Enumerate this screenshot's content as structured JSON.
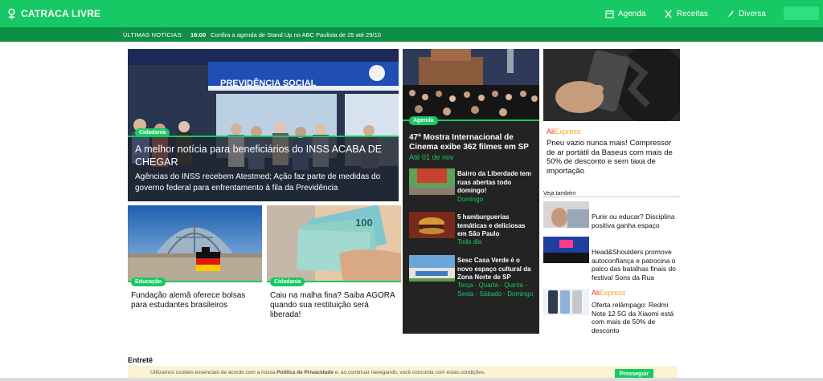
{
  "header": {
    "logo_text": "CATRACA LIVRE",
    "nav": [
      {
        "label": "Agenda",
        "icon": "calendar-icon"
      },
      {
        "label": "Receitas",
        "icon": "utensils-icon"
      },
      {
        "label": "Diversa",
        "icon": "feather-icon"
      }
    ],
    "brand_color": "#17c964"
  },
  "ticker": {
    "label": "ÚLTIMAS NOTÍCIAS:",
    "time": "16:00",
    "text": "Confira a agenda de Stand Up no ABC Paulista de 25 até 29/10"
  },
  "hero": {
    "image_sign": "PREVIDÊNCIA SOCIAL",
    "tag": "Cidadania",
    "title": "A melhor notícia para beneficiários do INSS ACABA DE CHEGAR",
    "subtitle": "Agências do INSS recebem Atestmed; Ação faz parte de medidas do governo federal para enfrentamento à fila da Previdência"
  },
  "card_educacao": {
    "tag": "Educação",
    "title": "Fundação alemã oferece bolsas para estudantes brasileiros"
  },
  "card_cidadania": {
    "tag": "Cidadania",
    "title": "Caiu na malha fina? Saiba AGORA quando sua restituição será liberada!",
    "banknote_value": "100"
  },
  "agenda": {
    "tag": "Agenda",
    "title": "47ª Mostra Internacional de Cinema exibe 362 filmes em SP",
    "date": "Até 01 de nov",
    "items": [
      {
        "title": "Bairro da Liberdade tem ruas abertas todo domingo!",
        "when": "Domingo"
      },
      {
        "title": "5 hamburguerias temáticas e deliciosas em São Paulo",
        "when": "Todo dia"
      },
      {
        "title": "Sesc Casa Verde é o novo espaço cultural da Zona Norte de SP",
        "when": "Terça - Quarta - Quinta - Sexta - Sábado - Domingo"
      }
    ]
  },
  "right_column": {
    "brand_ali": "Ali",
    "brand_express": "Express",
    "ad_title": "Pneu vazio nunca mais! Compressor de ar portátil da Baseus com mais de 50% de desconto e sem taxa de importação",
    "see_also": "Veja também",
    "items": [
      {
        "title": "Punir ou educar? Disciplina positiva ganha espaço"
      },
      {
        "title": "Head&Shoulders promove autoconfiança e patrocina o palco das batalhas finais do festival Sons da Rua"
      },
      {
        "title": "Oferta relâmpago: Redmi Note 12 5G da Xiaomi está com mais de 50% de desconto"
      }
    ]
  },
  "section": {
    "title": "Entretê"
  },
  "cookie": {
    "text_before": "Utilizamos cookies essenciais de acordo com a nossa ",
    "link": "Política de Privacidade",
    "text_after": " e, ao continuar navegando, você concorda com estas condições.",
    "button": "Prosseguir"
  }
}
